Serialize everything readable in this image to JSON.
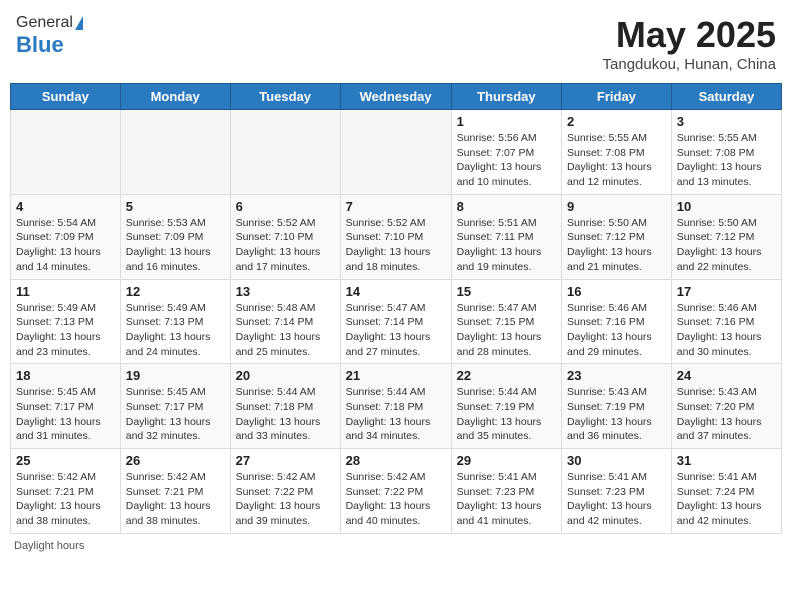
{
  "header": {
    "logo_general": "General",
    "logo_blue": "Blue",
    "month_title": "May 2025",
    "location": "Tangdukou, Hunan, China"
  },
  "days_of_week": [
    "Sunday",
    "Monday",
    "Tuesday",
    "Wednesday",
    "Thursday",
    "Friday",
    "Saturday"
  ],
  "footer": {
    "daylight_label": "Daylight hours"
  },
  "weeks": [
    [
      {
        "day": "",
        "empty": true
      },
      {
        "day": "",
        "empty": true
      },
      {
        "day": "",
        "empty": true
      },
      {
        "day": "",
        "empty": true
      },
      {
        "day": "1",
        "sunrise": "5:56 AM",
        "sunset": "7:07 PM",
        "daylight": "13 hours and 10 minutes."
      },
      {
        "day": "2",
        "sunrise": "5:55 AM",
        "sunset": "7:08 PM",
        "daylight": "13 hours and 12 minutes."
      },
      {
        "day": "3",
        "sunrise": "5:55 AM",
        "sunset": "7:08 PM",
        "daylight": "13 hours and 13 minutes."
      }
    ],
    [
      {
        "day": "4",
        "sunrise": "5:54 AM",
        "sunset": "7:09 PM",
        "daylight": "13 hours and 14 minutes."
      },
      {
        "day": "5",
        "sunrise": "5:53 AM",
        "sunset": "7:09 PM",
        "daylight": "13 hours and 16 minutes."
      },
      {
        "day": "6",
        "sunrise": "5:52 AM",
        "sunset": "7:10 PM",
        "daylight": "13 hours and 17 minutes."
      },
      {
        "day": "7",
        "sunrise": "5:52 AM",
        "sunset": "7:10 PM",
        "daylight": "13 hours and 18 minutes."
      },
      {
        "day": "8",
        "sunrise": "5:51 AM",
        "sunset": "7:11 PM",
        "daylight": "13 hours and 19 minutes."
      },
      {
        "day": "9",
        "sunrise": "5:50 AM",
        "sunset": "7:12 PM",
        "daylight": "13 hours and 21 minutes."
      },
      {
        "day": "10",
        "sunrise": "5:50 AM",
        "sunset": "7:12 PM",
        "daylight": "13 hours and 22 minutes."
      }
    ],
    [
      {
        "day": "11",
        "sunrise": "5:49 AM",
        "sunset": "7:13 PM",
        "daylight": "13 hours and 23 minutes."
      },
      {
        "day": "12",
        "sunrise": "5:49 AM",
        "sunset": "7:13 PM",
        "daylight": "13 hours and 24 minutes."
      },
      {
        "day": "13",
        "sunrise": "5:48 AM",
        "sunset": "7:14 PM",
        "daylight": "13 hours and 25 minutes."
      },
      {
        "day": "14",
        "sunrise": "5:47 AM",
        "sunset": "7:14 PM",
        "daylight": "13 hours and 27 minutes."
      },
      {
        "day": "15",
        "sunrise": "5:47 AM",
        "sunset": "7:15 PM",
        "daylight": "13 hours and 28 minutes."
      },
      {
        "day": "16",
        "sunrise": "5:46 AM",
        "sunset": "7:16 PM",
        "daylight": "13 hours and 29 minutes."
      },
      {
        "day": "17",
        "sunrise": "5:46 AM",
        "sunset": "7:16 PM",
        "daylight": "13 hours and 30 minutes."
      }
    ],
    [
      {
        "day": "18",
        "sunrise": "5:45 AM",
        "sunset": "7:17 PM",
        "daylight": "13 hours and 31 minutes."
      },
      {
        "day": "19",
        "sunrise": "5:45 AM",
        "sunset": "7:17 PM",
        "daylight": "13 hours and 32 minutes."
      },
      {
        "day": "20",
        "sunrise": "5:44 AM",
        "sunset": "7:18 PM",
        "daylight": "13 hours and 33 minutes."
      },
      {
        "day": "21",
        "sunrise": "5:44 AM",
        "sunset": "7:18 PM",
        "daylight": "13 hours and 34 minutes."
      },
      {
        "day": "22",
        "sunrise": "5:44 AM",
        "sunset": "7:19 PM",
        "daylight": "13 hours and 35 minutes."
      },
      {
        "day": "23",
        "sunrise": "5:43 AM",
        "sunset": "7:19 PM",
        "daylight": "13 hours and 36 minutes."
      },
      {
        "day": "24",
        "sunrise": "5:43 AM",
        "sunset": "7:20 PM",
        "daylight": "13 hours and 37 minutes."
      }
    ],
    [
      {
        "day": "25",
        "sunrise": "5:42 AM",
        "sunset": "7:21 PM",
        "daylight": "13 hours and 38 minutes."
      },
      {
        "day": "26",
        "sunrise": "5:42 AM",
        "sunset": "7:21 PM",
        "daylight": "13 hours and 38 minutes."
      },
      {
        "day": "27",
        "sunrise": "5:42 AM",
        "sunset": "7:22 PM",
        "daylight": "13 hours and 39 minutes."
      },
      {
        "day": "28",
        "sunrise": "5:42 AM",
        "sunset": "7:22 PM",
        "daylight": "13 hours and 40 minutes."
      },
      {
        "day": "29",
        "sunrise": "5:41 AM",
        "sunset": "7:23 PM",
        "daylight": "13 hours and 41 minutes."
      },
      {
        "day": "30",
        "sunrise": "5:41 AM",
        "sunset": "7:23 PM",
        "daylight": "13 hours and 42 minutes."
      },
      {
        "day": "31",
        "sunrise": "5:41 AM",
        "sunset": "7:24 PM",
        "daylight": "13 hours and 42 minutes."
      }
    ]
  ]
}
